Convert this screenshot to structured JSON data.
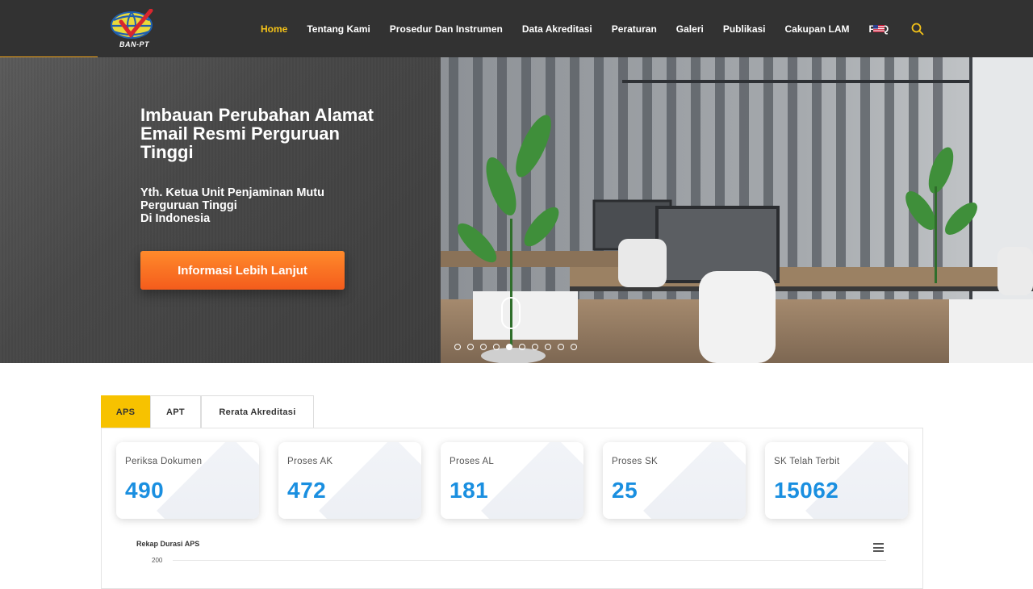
{
  "brand": {
    "logo_text": "BAN-PT"
  },
  "nav": {
    "items": [
      {
        "label": "Home",
        "active": true
      },
      {
        "label": "Tentang Kami"
      },
      {
        "label": "Prosedur Dan Instrumen"
      },
      {
        "label": "Data Akreditasi"
      },
      {
        "label": "Peraturan"
      },
      {
        "label": "Galeri"
      },
      {
        "label": "Publikasi"
      },
      {
        "label": "Cakupan LAM"
      },
      {
        "label": "FAQ"
      }
    ],
    "language_icon": "us-flag-icon",
    "search_icon": "search-icon"
  },
  "hero": {
    "title": "Imbauan Perubahan Alamat Email Resmi Perguruan Tinggi",
    "subtitle_lines": [
      "Yth. Ketua Unit Penjaminan Mutu",
      "Perguruan Tinggi",
      "Di Indonesia"
    ],
    "button_label": "Informasi Lebih Lanjut",
    "slide_count": 10,
    "active_slide": 5
  },
  "tabs": [
    {
      "label": "APS",
      "active": true
    },
    {
      "label": "APT"
    },
    {
      "label": "Rerata Akreditasi"
    }
  ],
  "stats": [
    {
      "label": "Periksa Dokumen",
      "value": "490"
    },
    {
      "label": "Proses AK",
      "value": "472"
    },
    {
      "label": "Proses AL",
      "value": "181"
    },
    {
      "label": "Proses SK",
      "value": "25"
    },
    {
      "label": "SK Telah Terbit",
      "value": "15062"
    }
  ],
  "chart": {
    "title": "Rekap Durasi APS",
    "y_tick_top": "200"
  },
  "colors": {
    "nav_bg": "#323232",
    "nav_active": "#f5c318",
    "accent_orange": "#f45c1c",
    "tab_active": "#f7c200",
    "stat_value": "#1a8fe0"
  }
}
